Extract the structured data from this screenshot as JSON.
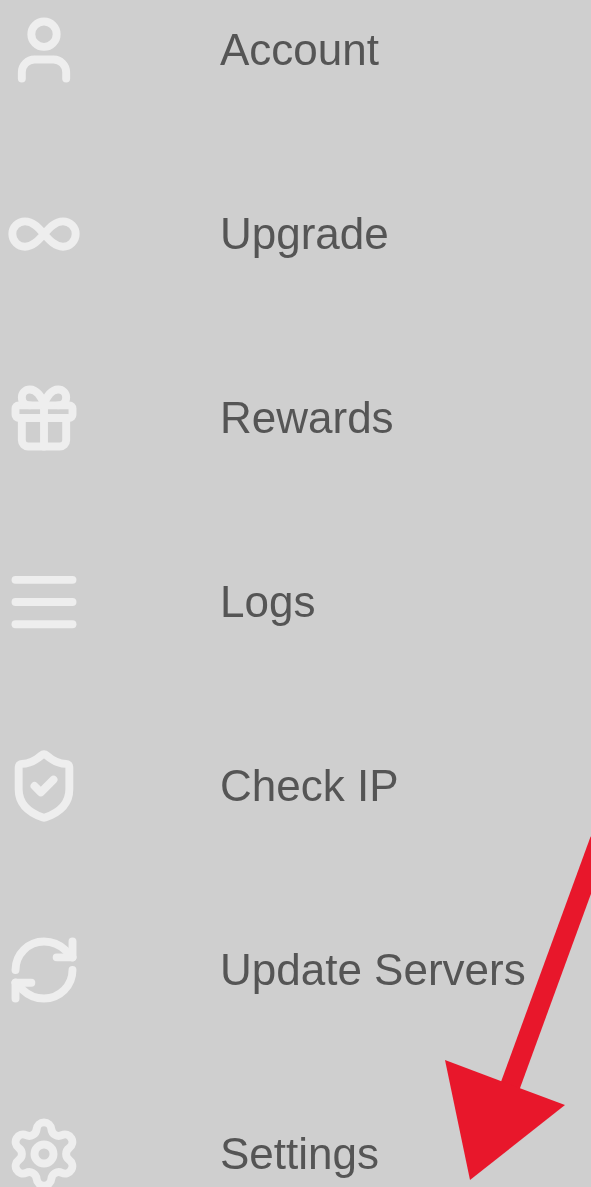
{
  "menu": {
    "items": [
      {
        "label": "Account"
      },
      {
        "label": "Upgrade"
      },
      {
        "label": "Rewards"
      },
      {
        "label": "Logs"
      },
      {
        "label": "Check IP"
      },
      {
        "label": "Update Servers"
      },
      {
        "label": "Settings"
      }
    ]
  }
}
